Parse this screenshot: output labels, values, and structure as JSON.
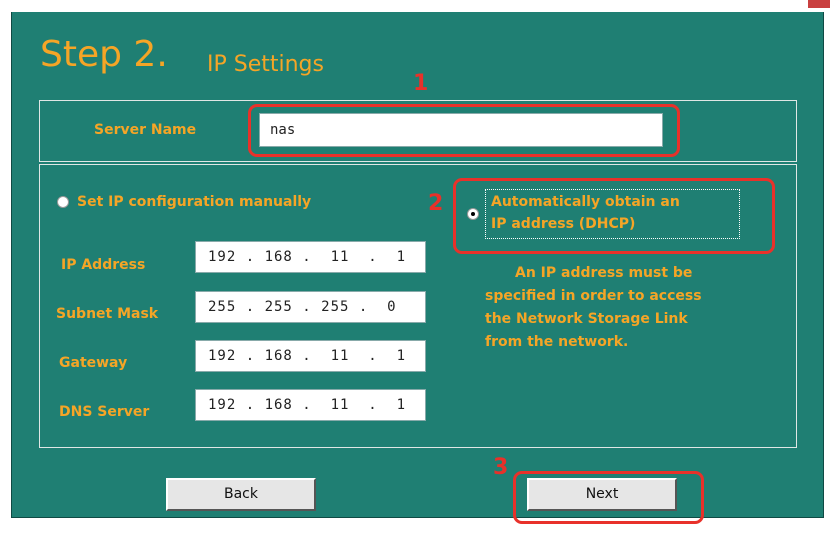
{
  "wizard": {
    "step_number": "Step 2.",
    "step_title": "IP Settings"
  },
  "server": {
    "label": "Server Name",
    "value": "nas"
  },
  "manual": {
    "radio_label": "Set IP configuration manually",
    "selected": false,
    "fields": {
      "ip_address": {
        "label": "IP Address",
        "value": "192 . 168 .  11  .  1"
      },
      "subnet_mask": {
        "label": "Subnet Mask",
        "value": "255 . 255 . 255 .  0"
      },
      "gateway": {
        "label": "Gateway",
        "value": "192 . 168 .  11  .  1"
      },
      "dns_server": {
        "label": "DNS Server",
        "value": "192 . 168 .  11  .  1"
      }
    }
  },
  "dhcp": {
    "label_line1": "Automatically obtain an",
    "label_line2": "IP address (DHCP)",
    "selected": true
  },
  "note": {
    "line1": "An IP address must be",
    "line2": "specified in order to access",
    "line3": "the Network Storage Link",
    "line4": "from the network."
  },
  "buttons": {
    "back_label": "Back",
    "next_label": "Next"
  },
  "annotations": {
    "marker1": "1",
    "marker2": "2",
    "marker3": "3"
  },
  "colors": {
    "panel_background": "#1f7f73",
    "label_orange": "#f5a526",
    "highlight_red": "#e8312a"
  }
}
